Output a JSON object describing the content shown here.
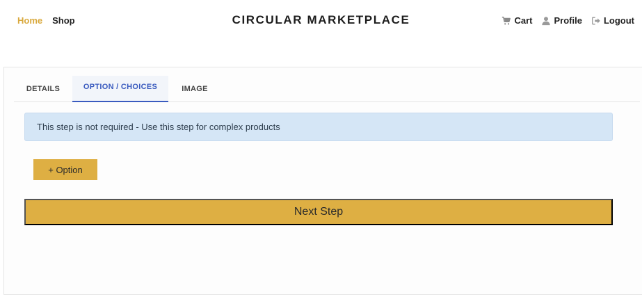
{
  "nav": {
    "home_label": "Home",
    "shop_label": "Shop",
    "brand": "CIRCULAR MARKETPLACE",
    "cart_label": "Cart",
    "profile_label": "Profile",
    "logout_label": "Logout"
  },
  "tabs": [
    {
      "label": "DETAILS",
      "active": false
    },
    {
      "label": "OPTION / CHOICES",
      "active": true
    },
    {
      "label": "IMAGE",
      "active": false
    }
  ],
  "alert": {
    "text": "This step is not required - Use this step for complex products"
  },
  "buttons": {
    "add_option": "+ Option",
    "next_step": "Next Step"
  },
  "colors": {
    "accent": "#deaf43",
    "active_nav": "#d9a93d",
    "active_tab": "#3a5bbf",
    "alert_bg": "#d5e6f6"
  },
  "icons": {
    "cart": "cart-icon",
    "profile": "user-icon",
    "logout": "logout-icon"
  }
}
